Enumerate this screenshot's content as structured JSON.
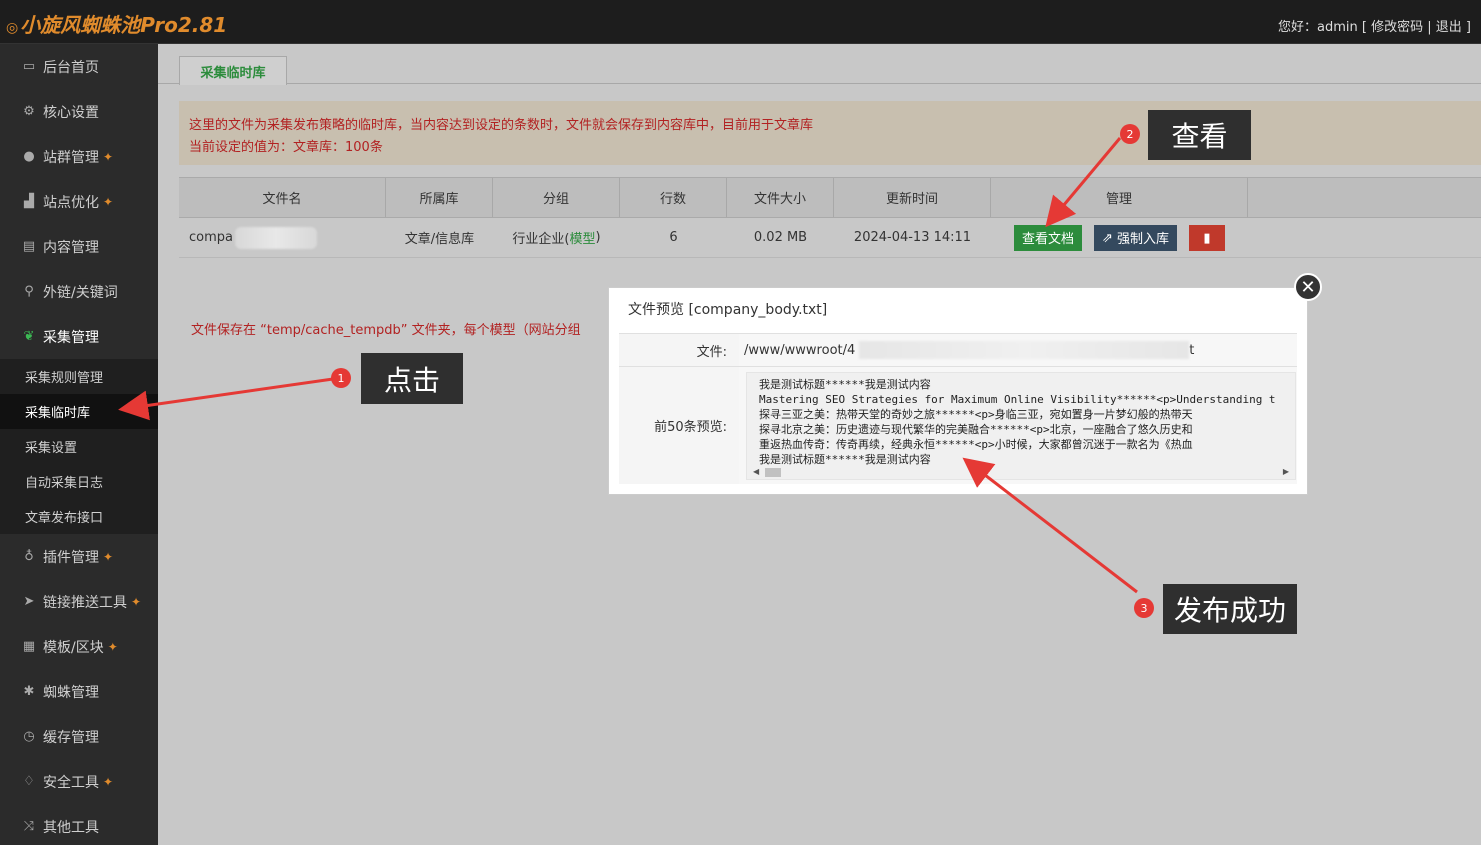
{
  "app": {
    "title": "小旋风蜘蛛池Pro2.81",
    "greeting": "您好：admin",
    "change_password": "[ 修改密码 |",
    "logout": "退出 ]"
  },
  "sidebar": {
    "items": [
      {
        "label": "后台首页",
        "icon": "monitor-icon"
      },
      {
        "label": "核心设置",
        "icon": "gear-icon"
      },
      {
        "label": "站群管理",
        "icon": "user-icon",
        "pinned": true
      },
      {
        "label": "站点优化",
        "icon": "chart-icon",
        "pinned": true
      },
      {
        "label": "内容管理",
        "icon": "document-icon"
      },
      {
        "label": "外链/关键词",
        "icon": "key-icon"
      },
      {
        "label": "采集管理",
        "icon": "leaf-icon"
      }
    ],
    "sub_items": [
      "采集规则管理",
      "采集临时库",
      "采集设置",
      "自动采集日志",
      "文章发布接口"
    ],
    "items_after": [
      {
        "label": "插件管理",
        "icon": "plug-icon",
        "pinned": true
      },
      {
        "label": "链接推送工具",
        "icon": "send-icon",
        "pinned": true
      },
      {
        "label": "模板/区块",
        "icon": "grid-icon",
        "pinned": true
      },
      {
        "label": "蜘蛛管理",
        "icon": "spider-icon"
      },
      {
        "label": "缓存管理",
        "icon": "clock-icon"
      },
      {
        "label": "安全工具",
        "icon": "bulb-icon",
        "pinned": true
      },
      {
        "label": "其他工具",
        "icon": "shuffle-icon"
      }
    ]
  },
  "main": {
    "tab": "采集临时库",
    "notice_line1": "这里的文件为采集发布策略的临时库，当内容达到设定的条数时，文件就会保存到内容库中，目前用于文章库",
    "notice_line2": "当前设定的值为：文章库：100条",
    "table": {
      "headers": [
        "文件名",
        "所属库",
        "分组",
        "行数",
        "文件大小",
        "更新时间",
        "管理",
        ""
      ],
      "row": {
        "filename": "compa",
        "library": "文章/信息库",
        "group_prefix": "行业企业(",
        "group_link": "模型",
        "group_suffix": ")",
        "lines": "6",
        "size": "0.02 MB",
        "updated": "2024-04-13 14:11",
        "btn_view": "查看文档",
        "btn_force": "强制入库"
      }
    },
    "bottom_note": "文件保存在 “temp/cache_tempdb” 文件夹，每个模型（网站分组"
  },
  "modal": {
    "title": "文件预览 [company_body.txt]",
    "file_label": "文件:",
    "file_path": "/www/wwwroot/4",
    "file_tail": "t",
    "preview_label": "前50条预览:",
    "preview_lines": [
      "我是测试标题******我是测试内容",
      "Mastering SEO Strategies for Maximum Online Visibility******<p>Understanding t",
      "探寻三亚之美：热带天堂的奇妙之旅******<p>身临三亚，宛如置身一片梦幻般的热带天",
      "探寻北京之美：历史遗迹与现代繁华的完美融合******<p>北京，一座融合了悠久历史和",
      "重返热血传奇：传奇再续，经典永恒******<p>小时候，大家都曾沉迷于一款名为《热血",
      "我是测试标题******我是测试内容"
    ]
  },
  "annotations": {
    "callout1": {
      "num": "1",
      "text": "点击"
    },
    "callout2": {
      "num": "2",
      "text": "查看"
    },
    "callout3": {
      "num": "3",
      "text": "发布成功"
    }
  }
}
